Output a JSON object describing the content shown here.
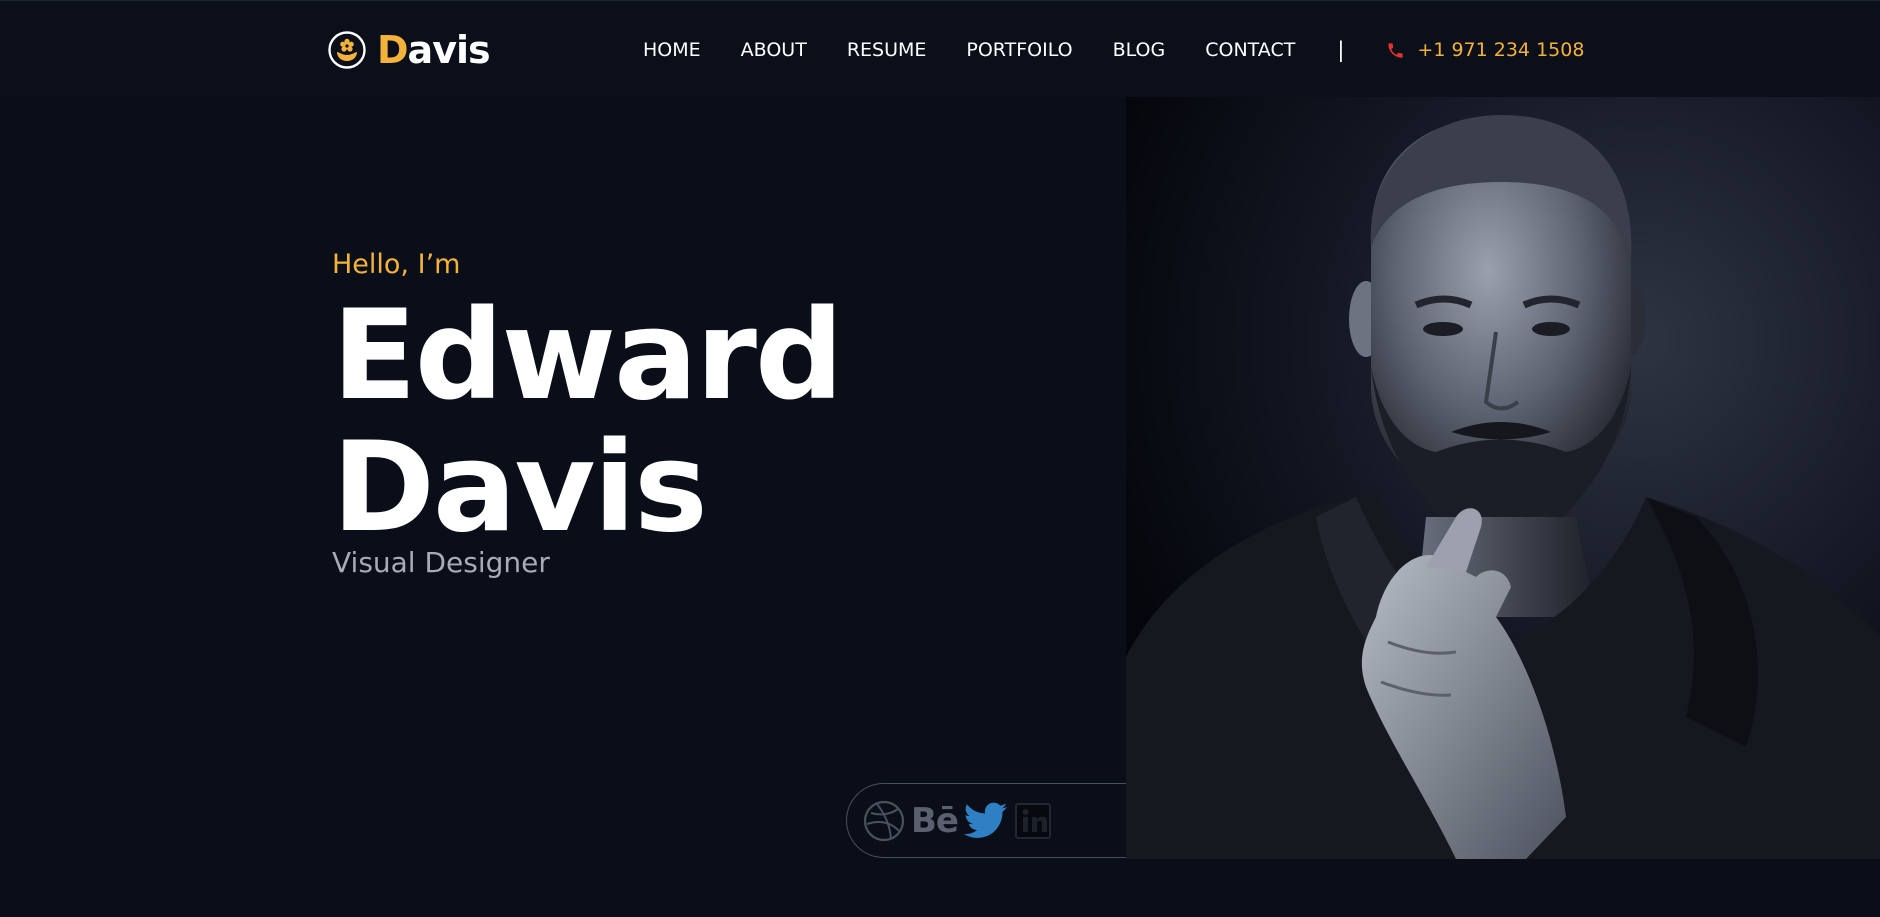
{
  "brand": {
    "first_letter": "D",
    "rest": "avis",
    "icon": "flower-hand-icon",
    "accent_color": "#f3b23a"
  },
  "nav": {
    "items": [
      {
        "label": "HOME"
      },
      {
        "label": "ABOUT"
      },
      {
        "label": "RESUME"
      },
      {
        "label": "PORTFOILO"
      },
      {
        "label": "BLOG"
      },
      {
        "label": "CONTACT"
      }
    ],
    "divider": "|",
    "phone": {
      "icon": "phone-icon",
      "number": "+1 971 234 1508"
    }
  },
  "hero": {
    "greeting": "Hello, I’m",
    "name_line1": "Edward",
    "name_line2": "Davis",
    "role": "Visual Designer",
    "photo": "portrait-photo"
  },
  "social": {
    "icons": [
      "dribbble-icon",
      "behance-icon",
      "twitter-icon",
      "linkedin-icon"
    ],
    "behance_label": "Bē",
    "linkedin_label": "in"
  },
  "colors": {
    "background": "#0a0e19",
    "header": "#0b0f1a",
    "accent": "#f3b23a",
    "text": "#ffffff",
    "muted": "#a7abb6",
    "twitter": "#2e7fc4",
    "phone_icon": "#e5322e"
  }
}
